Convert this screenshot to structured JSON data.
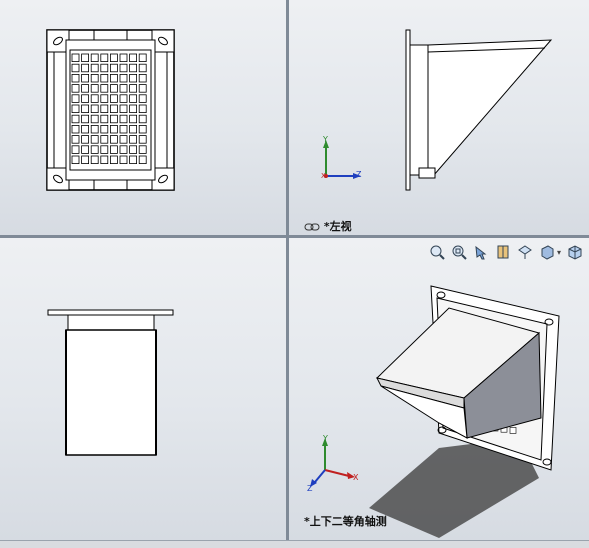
{
  "viewports": {
    "top_left": {
      "label": ""
    },
    "top_right": {
      "label": "*左视",
      "triad": {
        "y": "Y",
        "z": "Z",
        "x": "X"
      }
    },
    "bottom_left": {
      "label": ""
    },
    "bottom_right": {
      "label": "*上下二等角轴测",
      "triad": {
        "y": "Y",
        "z": "Z",
        "x": "X"
      }
    }
  },
  "toolbar": {
    "buttons": [
      {
        "name": "zoom-to-fit-icon"
      },
      {
        "name": "zoom-to-area-icon"
      },
      {
        "name": "previous-view-icon"
      },
      {
        "name": "section-view-icon"
      },
      {
        "name": "view-orientation-icon"
      },
      {
        "name": "display-style-icon"
      },
      {
        "name": "hide-show-items-icon"
      }
    ]
  },
  "colors": {
    "viewport_bg_top": "#eef0f3",
    "viewport_bg_bottom": "#d6dbe2",
    "splitter": "#7f8a97",
    "axis_y": "#2e8b2e",
    "axis_z": "#1f3fbf",
    "axis_x": "#c02020"
  }
}
